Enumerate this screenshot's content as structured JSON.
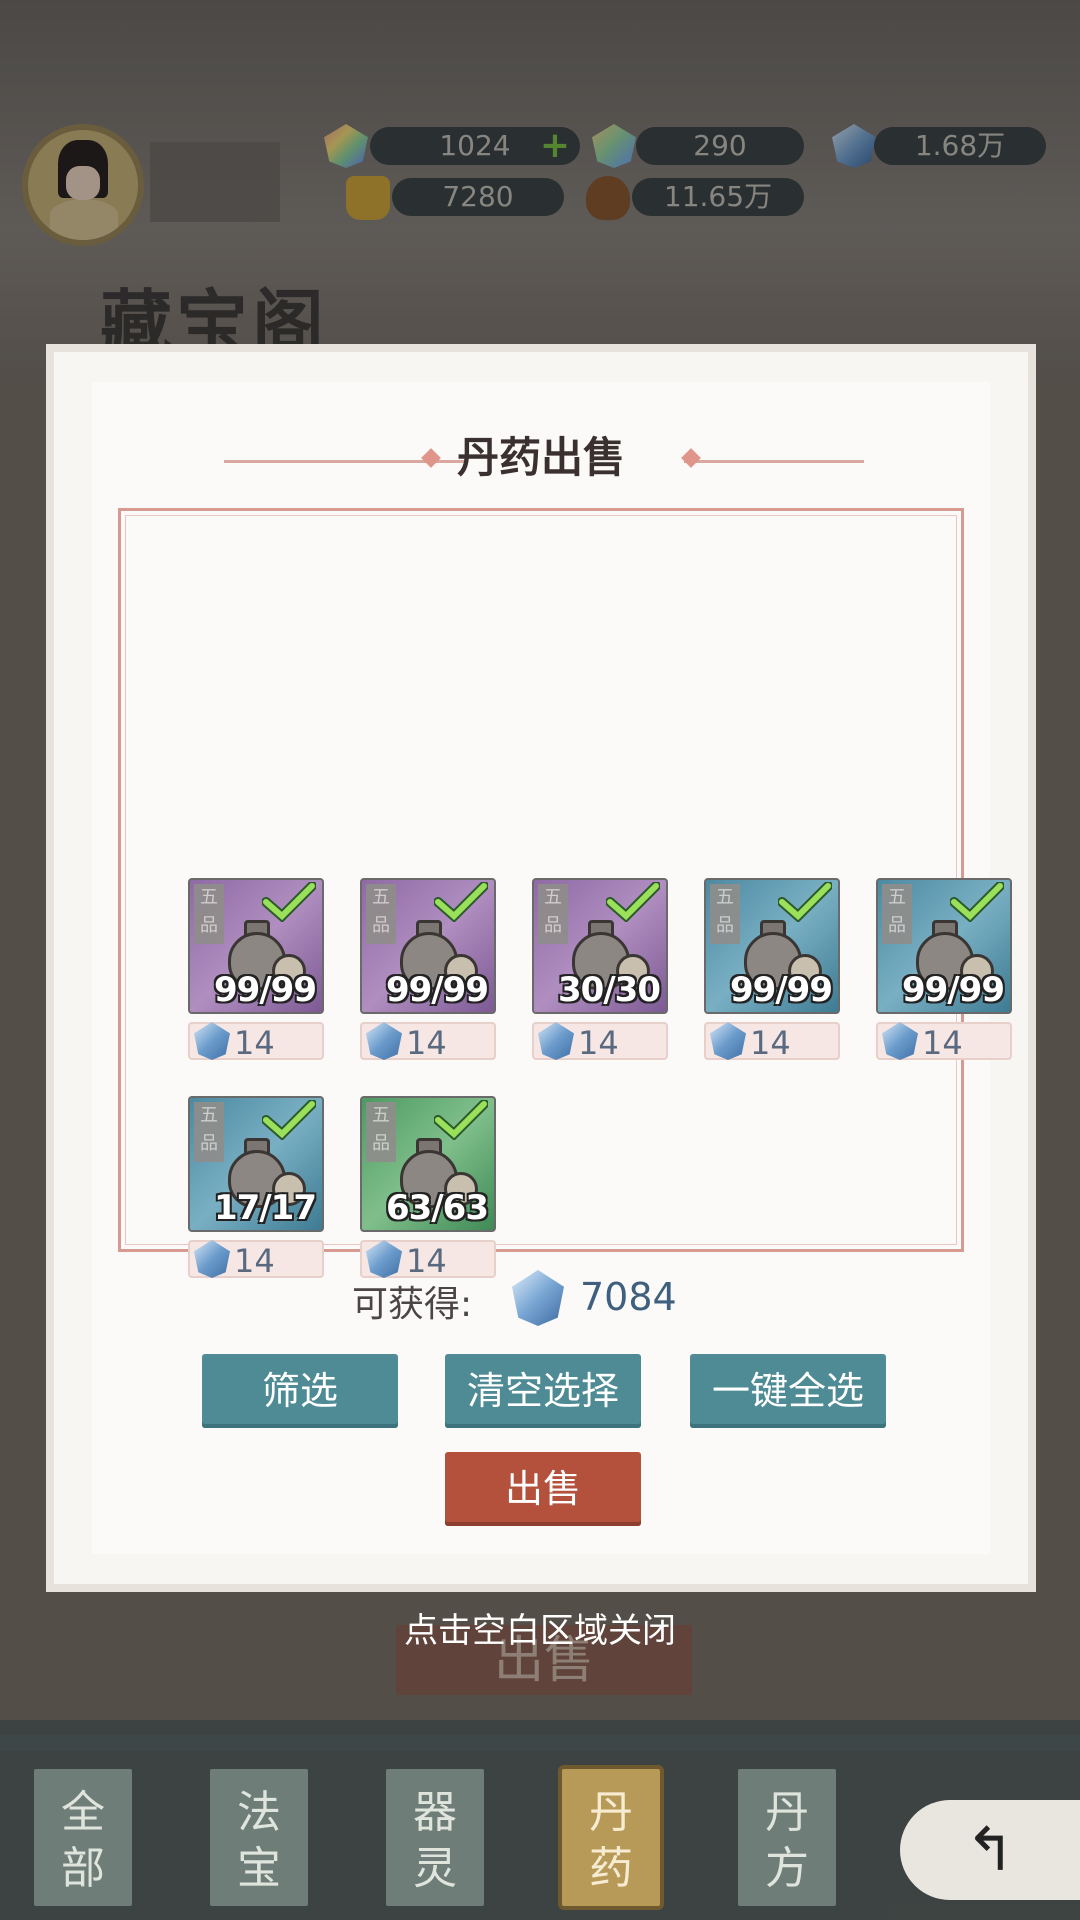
{
  "resources": {
    "rainbow_crystal": {
      "value": "1024",
      "icon": "rainbow-crystal-icon"
    },
    "crystal_two": {
      "value": "290",
      "icon": "crystal-icon"
    },
    "spirit_stone": {
      "value": "1.68万",
      "icon": "blue-gem-icon"
    },
    "gold": {
      "value": "7280",
      "icon": "gold-ingot-icon"
    },
    "pouch": {
      "value": "11.65万",
      "icon": "pouch-icon"
    }
  },
  "background_title": "藏宝阁",
  "modal": {
    "title": "丹药出售",
    "items": [
      {
        "grade": "五品",
        "count": "99/99",
        "price": "14",
        "color": "purple",
        "selected": true
      },
      {
        "grade": "五品",
        "count": "99/99",
        "price": "14",
        "color": "purple",
        "selected": true
      },
      {
        "grade": "五品",
        "count": "30/30",
        "price": "14",
        "color": "purple",
        "selected": true
      },
      {
        "grade": "五品",
        "count": "99/99",
        "price": "14",
        "color": "blue",
        "selected": true
      },
      {
        "grade": "五品",
        "count": "99/99",
        "price": "14",
        "color": "blue",
        "selected": true
      },
      {
        "grade": "五品",
        "count": "17/17",
        "price": "14",
        "color": "blue",
        "selected": true
      },
      {
        "grade": "五品",
        "count": "63/63",
        "price": "14",
        "color": "green",
        "selected": true
      }
    ],
    "gain_label": "可获得:",
    "gain_value": "7084",
    "buttons": {
      "filter": "筛选",
      "clear": "清空选择",
      "select_all": "一键全选",
      "sell": "出售"
    }
  },
  "close_hint": "点击空白区域关闭",
  "ghost_sell": "出售",
  "tabs": [
    {
      "label": "全部",
      "active": false
    },
    {
      "label": "法宝",
      "active": false
    },
    {
      "label": "器灵",
      "active": false
    },
    {
      "label": "丹药",
      "active": true
    },
    {
      "label": "丹方",
      "active": false
    }
  ],
  "colors": {
    "purple": "#8f6aa5",
    "blue": "#4d8aa2",
    "green": "#4e9a63",
    "teal_button": "#4e8b95",
    "sell_button": "#b4513c"
  }
}
